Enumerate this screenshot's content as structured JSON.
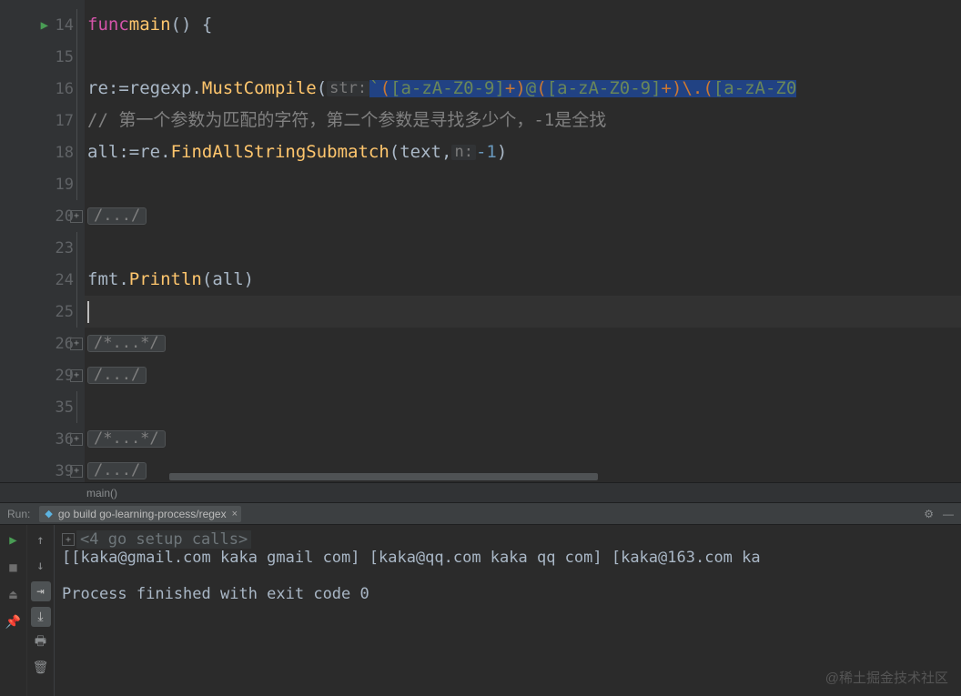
{
  "editor": {
    "lines": [
      {
        "num": "14",
        "run": true,
        "fold": "vline"
      },
      {
        "num": "15"
      },
      {
        "num": "16"
      },
      {
        "num": "17"
      },
      {
        "num": "18"
      },
      {
        "num": "19"
      },
      {
        "num": "20",
        "fold": "plus"
      },
      {
        "num": "23"
      },
      {
        "num": "24"
      },
      {
        "num": "25",
        "current": true
      },
      {
        "num": "26",
        "fold": "plus"
      },
      {
        "num": "29",
        "fold": "plus"
      },
      {
        "num": "35"
      },
      {
        "num": "36",
        "fold": "plus"
      },
      {
        "num": "39",
        "fold": "plus"
      }
    ],
    "tokens": {
      "l14_func": "func",
      "l14_main": "main",
      "l14_brace": "() {",
      "l16_re": "re",
      "l16_assign": ":=",
      "l16_regexp": "regexp",
      "l16_dot": ".",
      "l16_must": "MustCompile",
      "l16_lparen": "(",
      "l16_hint": "str:",
      "l16_str_open": "`",
      "l16_str_paren1": "(",
      "l16_str_bracket1": "[a-zA-Z0-9]",
      "l16_str_plus1": "+",
      "l16_str_paren1c": ")",
      "l16_str_at": "@",
      "l16_str_paren2": "(",
      "l16_str_bracket2": "[a-zA-Z0-9]",
      "l16_str_plus2": "+",
      "l16_str_paren2c": ")",
      "l16_str_esc": "\\.",
      "l16_str_paren3": "(",
      "l16_str_bracket3": "[a-zA-Z0",
      "l17_comment": "// 第一个参数为匹配的字符，第二个参数是寻找多少个，-1是全找",
      "l18_all": "all",
      "l18_assign": ":=",
      "l18_re": "re",
      "l18_dot": ".",
      "l18_find": "FindAllStringSubmatch",
      "l18_lparen": "(",
      "l18_text": "text",
      "l18_comma": ",",
      "l18_hint": "n:",
      "l18_neg1": "-1",
      "l18_rparen": ")",
      "l20_fold": "/.../",
      "l24_fmt": "fmt",
      "l24_dot": ".",
      "l24_println": "Println",
      "l24_lparen": "(",
      "l24_all": "all",
      "l24_rparen": ")",
      "l26_fold": "/*...*/",
      "l29_fold": "/.../",
      "l36_fold": "/*...*/",
      "l39_fold": "/.../"
    },
    "breadcrumb": "main()"
  },
  "run": {
    "label": "Run:",
    "tab": "go build go-learning-process/regex",
    "console_fold": "<4 go setup calls>",
    "output": "[[kaka@gmail.com kaka gmail com] [kaka@qq.com kaka qq com] [kaka@163.com ka",
    "exit": "Process finished with exit code 0"
  },
  "watermark": "@稀土掘金技术社区"
}
